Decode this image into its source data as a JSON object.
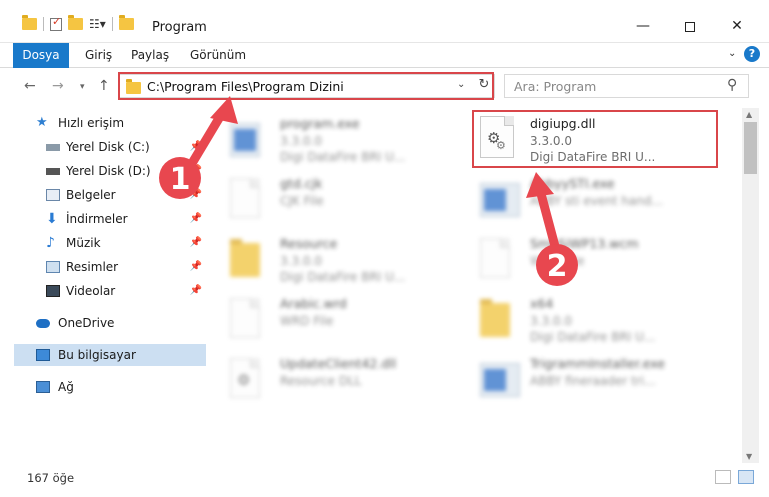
{
  "window": {
    "title": "Program",
    "minimize": "—",
    "maximize": "",
    "close": "✕"
  },
  "ribbon": {
    "tabs": [
      "Dosya",
      "Giriş",
      "Paylaş",
      "Görünüm"
    ],
    "help": "?"
  },
  "nav": {
    "back": "←",
    "forward": "→",
    "recent": "▾",
    "up": "↑",
    "address": "C:\\Program Files\\Program Dizini",
    "search_placeholder": "Ara: Program"
  },
  "sidebar": {
    "items": [
      {
        "label": "Hızlı erişim",
        "icon": "star-icon",
        "pinned": false
      },
      {
        "label": "Yerel Disk (C:)",
        "icon": "disk-icon",
        "pinned": true
      },
      {
        "label": "Yerel Disk (D:)",
        "icon": "disk-icon",
        "pinned": true
      },
      {
        "label": "Belgeler",
        "icon": "documents-icon",
        "pinned": true
      },
      {
        "label": "İndirmeler",
        "icon": "download-icon",
        "pinned": true
      },
      {
        "label": "Müzik",
        "icon": "music-icon",
        "pinned": true
      },
      {
        "label": "Resimler",
        "icon": "pictures-icon",
        "pinned": true
      },
      {
        "label": "Videolar",
        "icon": "video-icon",
        "pinned": true
      },
      {
        "label": "OneDrive",
        "icon": "cloud-icon",
        "pinned": false
      },
      {
        "label": "Bu bilgisayar",
        "icon": "computer-icon",
        "pinned": false
      },
      {
        "label": "Ağ",
        "icon": "network-icon",
        "pinned": false
      }
    ]
  },
  "files": {
    "left": [
      {
        "name": "program.exe",
        "meta1": "3.3.0.0",
        "meta2": "Digi DataFire BRI U..."
      },
      {
        "name": "gtd.cjk",
        "meta1": "CJK File",
        "meta2": ""
      },
      {
        "name": "Resource",
        "meta1": "3.3.0.0",
        "meta2": "Digi DataFire BRI U..."
      },
      {
        "name": "Arabic.wrd",
        "meta1": "WRD File",
        "meta2": ""
      },
      {
        "name": "UpdateClient42.dll",
        "meta1": "Resource DLL",
        "meta2": ""
      }
    ],
    "right": [
      {
        "name": "digiupg.dll",
        "meta1": "3.3.0.0",
        "meta2": "Digi DataFire BRI U..."
      },
      {
        "name": "AbbyySTI.exe",
        "meta1": "ABBY sti event hand...",
        "meta2": ""
      },
      {
        "name": "SmbSiWP13.wcm",
        "meta1": "WCM File",
        "meta2": ""
      },
      {
        "name": "x64",
        "meta1": "3.3.0.0",
        "meta2": "Digi DataFire BRI U..."
      },
      {
        "name": "TrigrammInstaller.exe",
        "meta1": "ABBY fineraader tri...",
        "meta2": ""
      }
    ]
  },
  "annotations": {
    "badge1": "1",
    "badge2": "2"
  },
  "status": {
    "count": "167 öğe"
  }
}
